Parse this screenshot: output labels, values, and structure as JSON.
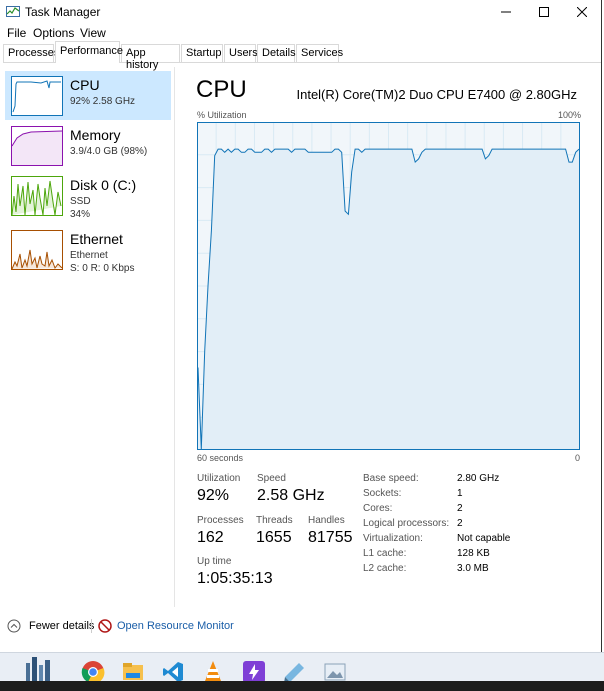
{
  "window": {
    "title": "Task Manager"
  },
  "menu": [
    "File",
    "Options",
    "View"
  ],
  "tabs": [
    "Processes",
    "Performance",
    "App history",
    "Startup",
    "Users",
    "Details",
    "Services"
  ],
  "resources": [
    {
      "name": "CPU",
      "line1": "92% 2.58 GHz",
      "line2": ""
    },
    {
      "name": "Memory",
      "line1": "3.9/4.0 GB (98%)",
      "line2": ""
    },
    {
      "name": "Disk 0 (C:)",
      "line1": "SSD",
      "line2": "34%"
    },
    {
      "name": "Ethernet",
      "line1": "Ethernet",
      "line2": "S: 0 R: 0 Kbps"
    }
  ],
  "cpu": {
    "title": "CPU",
    "model": "Intel(R) Core(TM)2 Duo CPU E7400 @ 2.80GHz",
    "graph": {
      "y_label": "% Utilization",
      "y_max_label": "100%",
      "x_left_label": "60 seconds",
      "x_right_label": "0",
      "ylim": [
        0,
        100
      ],
      "series": [
        25,
        0,
        30,
        50,
        67,
        90,
        92,
        92,
        91,
        92,
        91,
        92,
        92,
        91,
        91,
        92,
        92,
        91,
        91,
        91,
        92,
        92,
        91,
        92,
        92,
        92,
        92,
        92,
        91,
        92,
        92,
        92,
        92,
        91,
        91,
        91,
        91,
        91,
        91,
        91,
        91,
        92,
        92,
        91,
        73,
        72,
        85,
        92,
        92,
        91,
        92,
        92,
        92,
        92,
        92,
        92,
        92,
        92,
        92,
        92,
        92,
        92,
        92,
        92,
        92,
        88,
        89,
        91,
        92,
        92,
        92,
        92,
        92,
        92,
        92,
        92,
        92,
        92,
        92,
        92,
        92,
        92,
        92,
        92,
        92,
        92,
        89,
        90,
        92,
        92,
        92,
        92,
        92,
        92,
        92,
        92,
        92,
        92,
        92,
        92,
        92,
        92,
        92,
        92,
        92,
        92,
        92,
        92,
        92,
        92,
        92,
        88,
        88,
        91,
        92
      ]
    },
    "stats": {
      "utilization_label": "Utilization",
      "utilization": "92%",
      "speed_label": "Speed",
      "speed": "2.58 GHz",
      "processes_label": "Processes",
      "processes": "162",
      "threads_label": "Threads",
      "threads": "1655",
      "handles_label": "Handles",
      "handles": "81755",
      "uptime_label": "Up time",
      "uptime": "1:05:35:13"
    },
    "details": [
      {
        "label": "Base speed:",
        "value": "2.80 GHz"
      },
      {
        "label": "Sockets:",
        "value": "1"
      },
      {
        "label": "Cores:",
        "value": "2"
      },
      {
        "label": "Logical processors:",
        "value": "2"
      },
      {
        "label": "Virtualization:",
        "value": "Not capable"
      },
      {
        "label": "L1 cache:",
        "value": "128 KB"
      },
      {
        "label": "L2 cache:",
        "value": "3.0 MB"
      }
    ]
  },
  "bottom": {
    "fewer_details": "Fewer details",
    "open_monitor": "Open Resource Monitor"
  },
  "colors": {
    "accent": "#1174b7",
    "graph_fill": "#f1f6fa",
    "graph_grid": "#d9eaf4",
    "selected": "#cce8ff",
    "memory": "#8b12ae",
    "disk": "#4da60c",
    "ethernet": "#a74f01"
  },
  "taskbar_icons": [
    "city-icon",
    "chrome-icon",
    "file-explorer-icon",
    "vscode-icon",
    "vlc-icon",
    "power-icon",
    "notepad-icon",
    "image-viewer-icon"
  ]
}
